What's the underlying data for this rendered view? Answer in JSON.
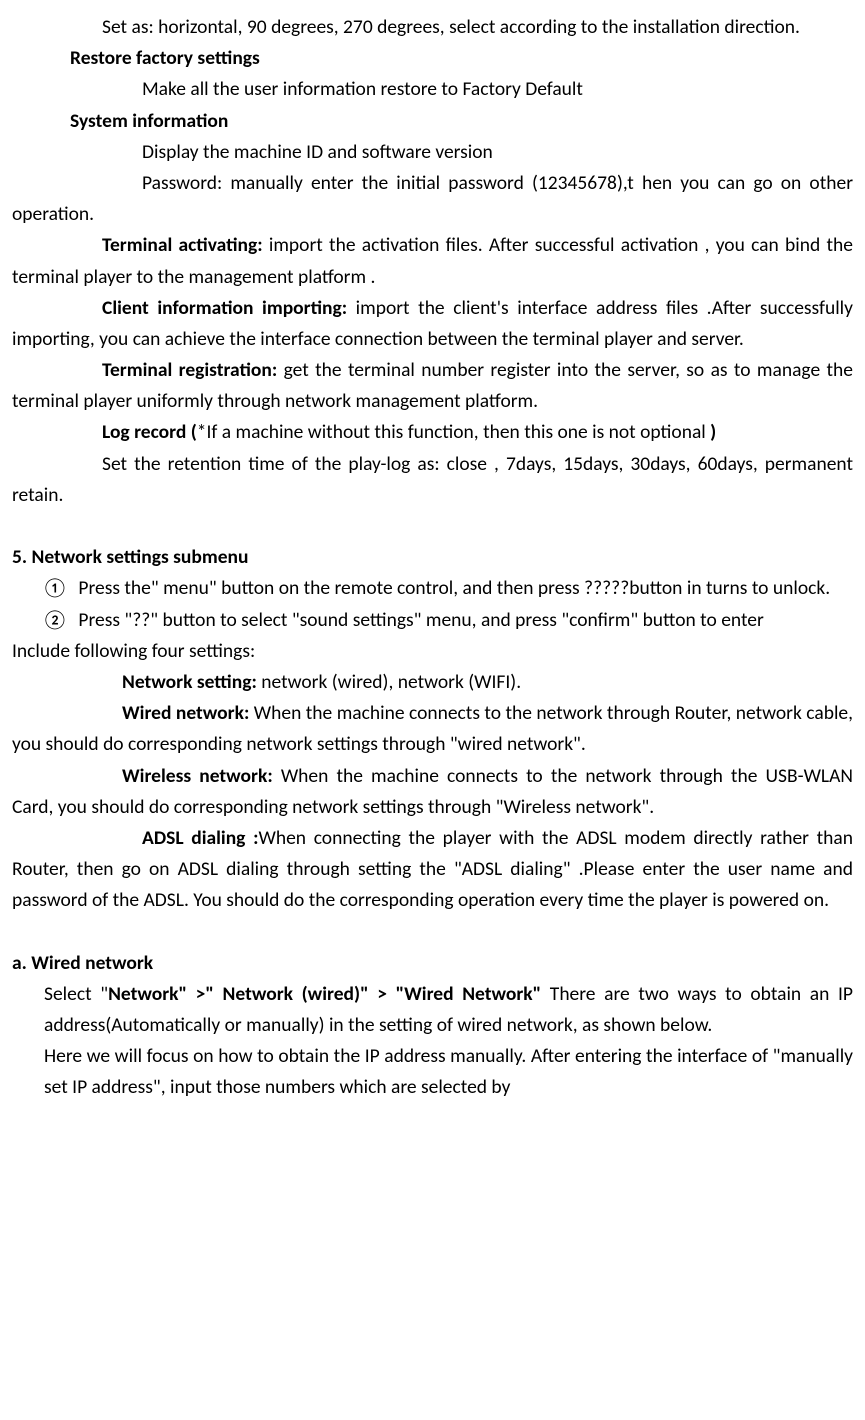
{
  "p1": "Set as: horizontal, 90 degrees, 270 degrees, select according to the installation direction.",
  "h_restore": "Restore factory settings",
  "p_restore": "Make all the user information restore to Factory Default",
  "h_sysinfo": "System information",
  "p_sysinfo1": "Display the machine ID and software version",
  "p_sysinfo2": "Password: manually enter the initial password (12345678),t hen you can go on other operation.",
  "h_termact": "Terminal activating:",
  "p_termact": "  import the activation files. After successful activation , you can bind the terminal player to the management platform .",
  "h_clientimp": "Client information importing:",
  "p_clientimp": " import the client's interface address files .After successfully importing, you can achieve the interface connection between the terminal player and server.",
  "h_termreg": "Terminal registration:",
  "p_termreg": " get the terminal number register into the server, so as to manage the terminal player uniformly through network management platform.",
  "h_log": "Log record (",
  "p_log_if": "*If a machine without this function, then this one is not optional ",
  "h_log_close": ")",
  "p_log2": "Set the retention time of the play-log as: close , 7days, 15days, 30days, 60days, permanent retain.",
  "h_section5": "5. Network settings submenu",
  "li1_marker": "①",
  "li1": "  Press the\" menu\" button on the remote control, and then press ?????button in turns to unlock.",
  "li2_marker": "②",
  "li2": " Press \"??\" button to select \"sound settings\" menu, and press  \"confirm\" button to enter",
  "p_include": "Include following four settings:",
  "h_netset": "Network setting:",
  "p_netset": " network (wired), network (WIFI).",
  "h_wired": "Wired network:",
  "p_wired": " When the machine connects to the network through Router, network cable,  you should do corresponding network  settings through \"wired network\".",
  "h_wireless": "Wireless network:",
  "p_wireless": " When the machine connects to the network through the USB-WLAN Card, you should do corresponding network settings through \"Wireless network\".",
  "h_adsl": "ADSL dialing :",
  "p_adsl": "When connecting the player with the ADSL modem directly rather than Router, then go on ADSL dialing through setting the \"ADSL dialing\" .Please enter the user   name and password of the ADSL. You should do the corresponding operation every time the player is powered   on.",
  "h_a": "a.  Wired network",
  "p_a1a": "Select \"",
  "p_a1b": "Network\" >\" Network (wired)\" > \"Wired Network\"",
  "p_a1c": " There are two ways to obtain an IP address(Automatically or manually) in the setting of wired network, as shown below.",
  "p_a2": "Here we will focus on how to obtain the IP address manually. After entering the interface of \"manually set IP address\", input those numbers which are selected by"
}
